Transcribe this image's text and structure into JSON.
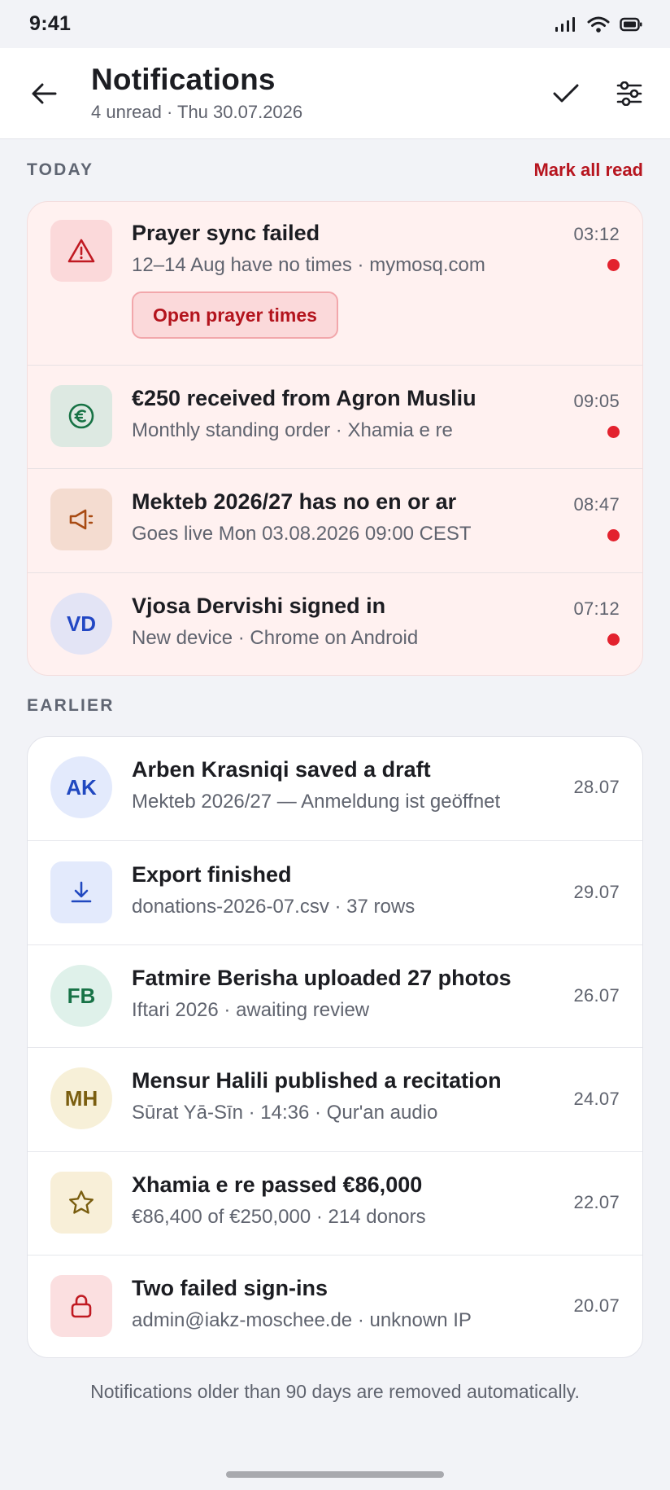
{
  "status_bar": {
    "time": "9:41"
  },
  "header": {
    "title": "Notifications",
    "subtitle": "4 unread · Thu 30.07.2026"
  },
  "today": {
    "label": "TODAY",
    "mark_all": "Mark all read",
    "items": [
      {
        "title": "Prayer sync failed",
        "sub": "12–14 Aug have no times · mymosq.com",
        "time": "03:12",
        "action": "Open prayer times",
        "icon": "warning-icon"
      },
      {
        "title": "€250 received from Agron Musliu",
        "sub": "Monthly standing order · Xhamia e re",
        "time": "09:05",
        "icon": "euro-icon"
      },
      {
        "title": "Mekteb 2026/27 has no en or ar",
        "sub": "Goes live Mon 03.08.2026 09:00 CEST",
        "time": "08:47",
        "icon": "megaphone-icon"
      },
      {
        "title": "Vjosa Dervishi signed in",
        "sub": "New device · Chrome on Android",
        "time": "07:12",
        "initials": "VD"
      }
    ]
  },
  "earlier": {
    "label": "EARLIER",
    "items": [
      {
        "title": "Arben Krasniqi saved a draft",
        "sub": "Mekteb 2026/27 — Anmeldung ist geöffnet",
        "time": "28.07",
        "initials": "AK"
      },
      {
        "title": "Export finished",
        "sub": "donations-2026-07.csv · 37 rows",
        "time": "29.07",
        "icon": "download-icon"
      },
      {
        "title": "Fatmire Berisha uploaded 27 photos",
        "sub": "Iftari 2026 · awaiting review",
        "time": "26.07",
        "initials": "FB"
      },
      {
        "title": "Mensur Halili published a recitation",
        "sub": "Sūrat Yā-Sīn · 14:36 · Qur'an audio",
        "time": "24.07",
        "initials": "MH"
      },
      {
        "title": "Xhamia e re passed €86,000",
        "sub": "€86,400 of €250,000 · 214 donors",
        "time": "22.07",
        "icon": "star-icon"
      },
      {
        "title": "Two failed sign-ins",
        "sub": "admin@iakz-moschee.de · unknown IP",
        "time": "20.07",
        "icon": "lock-icon"
      }
    ]
  },
  "footer": {
    "note": "Notifications older than 90 days are removed automatically."
  },
  "colors": {
    "accent_red": "#b7151f",
    "unread_dot": "#e3222e",
    "unread_bg": "#fff1f0"
  }
}
